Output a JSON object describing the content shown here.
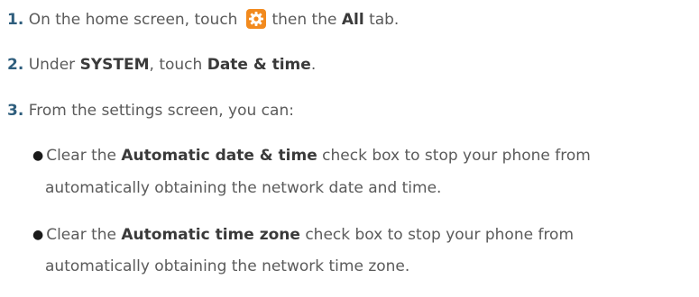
{
  "steps": [
    {
      "number": "1.",
      "text_a": "On the home screen, touch",
      "icon": "settings-gear-icon",
      "text_b": "then the",
      "bold_a": "All",
      "text_c": "tab."
    },
    {
      "number": "2.",
      "text_a": "Under",
      "bold_a": "SYSTEM",
      "text_b": ", touch",
      "bold_b": "Date & time",
      "text_c": "."
    },
    {
      "number": "3.",
      "text_a": "From the settings screen, you can:"
    }
  ],
  "bullets": [
    {
      "text_a": "Clear the",
      "bold_a": "Automatic date & time",
      "text_b": "check box to stop your phone from",
      "line2": "automatically obtaining the network date and time."
    },
    {
      "text_a": "Clear the",
      "bold_a": "Automatic time zone",
      "text_b": "check box to stop your phone from",
      "line2": "automatically obtaining the network time zone."
    }
  ],
  "colors": {
    "step_number": "#2f5e7d",
    "body_text": "#5a5a5a",
    "bold_text": "#3a3a3a",
    "icon_orange": "#f28a1e"
  }
}
